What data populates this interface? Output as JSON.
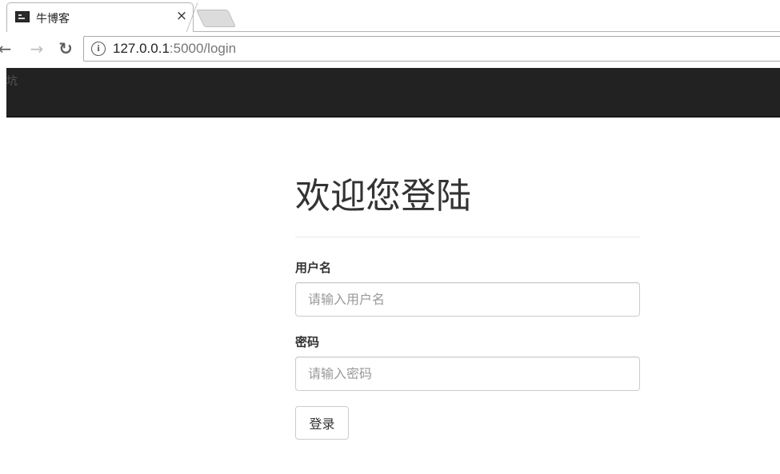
{
  "browser": {
    "tab": {
      "title": "牛博客",
      "close_glyph": "×",
      "favicon": "terminal-icon"
    },
    "nav": {
      "back_glyph": "←",
      "forward_glyph": "→",
      "reload_glyph": "↻"
    },
    "url": {
      "host": "127.0.0.1",
      "rest": ":5000/login"
    },
    "info_glyph": "i"
  },
  "navbar": {
    "brand": "坑",
    "background": "#222222"
  },
  "login": {
    "title": "欢迎您登陆",
    "username_label": "用户名",
    "username_placeholder": "请输入用户名",
    "username_value": "",
    "password_label": "密码",
    "password_placeholder": "请输入密码",
    "password_value": "",
    "submit_label": "登录"
  }
}
